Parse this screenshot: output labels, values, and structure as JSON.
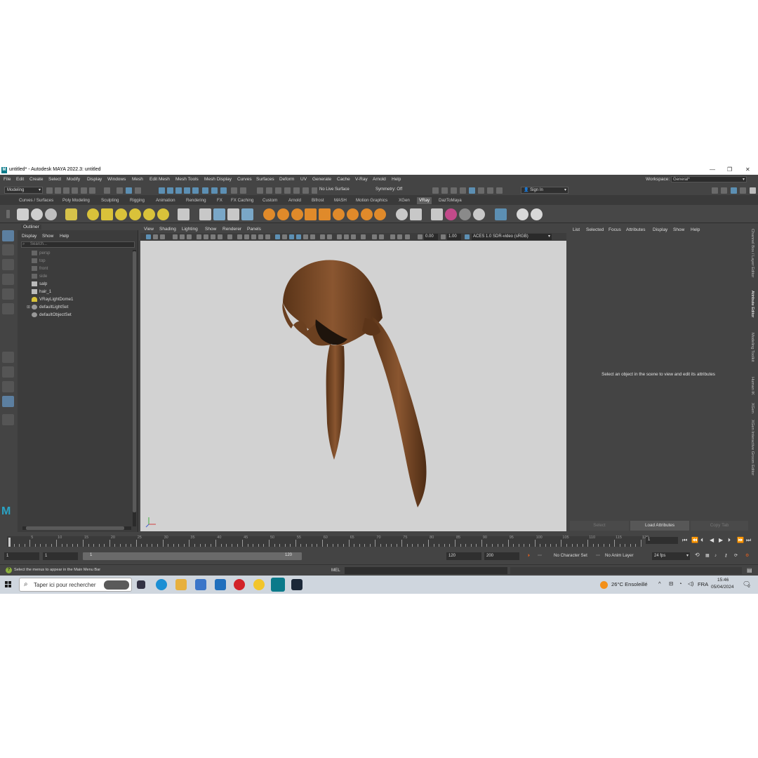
{
  "window": {
    "title": "untitled* - Autodesk MAYA 2022.3: untitled",
    "logo_letter": "M",
    "controls": [
      "—",
      "❐",
      "✕"
    ]
  },
  "menubar": {
    "items": [
      "File",
      "Edit",
      "Create",
      "Select",
      "Modify",
      "Display",
      "Windows",
      "Mesh",
      "Edit Mesh",
      "Mesh Tools",
      "Mesh Display",
      "Curves",
      "Surfaces",
      "Deform",
      "UV",
      "Generate",
      "Cache",
      "V-Ray",
      "Arnold",
      "Help"
    ],
    "workspace_label": "Workspace:",
    "workspace_value": "General*"
  },
  "statusline": {
    "menuset": "Modeling",
    "live_surface": "No Live Surface",
    "symmetry": "Symmetry: Off",
    "sign_in": "Sign In"
  },
  "shelf_tabs": [
    "Curves / Surfaces",
    "Poly Modeling",
    "Sculpting",
    "Rigging",
    "Animation",
    "Rendering",
    "FX",
    "FX Caching",
    "Custom",
    "Arnold",
    "Bifrost",
    "MASH",
    "Motion Graphics",
    "XGen",
    "VRay",
    "DazToMaya"
  ],
  "shelf_active": "VRay",
  "outliner": {
    "title": "Outliner",
    "menu": [
      "Display",
      "Show",
      "Help"
    ],
    "search_placeholder": "Search...",
    "items": [
      {
        "label": "persp",
        "icon": "camera-icon",
        "dim": true
      },
      {
        "label": "top",
        "icon": "camera-icon",
        "dim": true
      },
      {
        "label": "front",
        "icon": "camera-icon",
        "dim": true
      },
      {
        "label": "side",
        "icon": "camera-icon",
        "dim": true
      },
      {
        "label": "salp",
        "icon": "transform-icon",
        "dim": false
      },
      {
        "label": "hair_1",
        "icon": "transform-icon",
        "dim": false
      },
      {
        "label": "VRayLightDome1",
        "icon": "light-dome-icon",
        "dim": false
      },
      {
        "label": "defaultLightSet",
        "icon": "set-icon",
        "dim": false
      },
      {
        "label": "defaultObjectSet",
        "icon": "set-icon",
        "dim": false
      }
    ]
  },
  "viewport": {
    "menu": [
      "View",
      "Shading",
      "Lighting",
      "Show",
      "Renderer",
      "Panels"
    ],
    "near_value": "0.00",
    "gamma_value": "1.00",
    "color_space": "ACES 1.0 SDR-video (sRGB)",
    "background_color": "#d2d2d2",
    "hair_color": "#7a4a24"
  },
  "attribute_editor": {
    "menu": [
      "List",
      "Selected",
      "Focus",
      "Attributes",
      "Display",
      "Show",
      "Help"
    ],
    "message": "Select an object in the scene to view and edit its attributes",
    "buttons": [
      "Select",
      "Load Attributes",
      "Copy Tab"
    ]
  },
  "side_tabs": [
    "Channel Box / Layer Editor",
    "Attribute Editor",
    "Modeling Toolkit",
    "Human IK",
    "XGen",
    "XGen Interactive Groom Editor"
  ],
  "time_slider": {
    "labels": [
      "5",
      "10",
      "15",
      "20",
      "25",
      "30",
      "35",
      "40",
      "45",
      "50",
      "55",
      "60",
      "65",
      "70",
      "75",
      "80",
      "85",
      "90",
      "95",
      "100",
      "105",
      "110",
      "115",
      "120"
    ],
    "current_frame": "1",
    "playback_icons": [
      "⏮",
      "⏴⏴",
      "⏮",
      "◀",
      "▶",
      "⏭",
      "⏵⏵",
      "⏭"
    ]
  },
  "range_slider": {
    "start": "1",
    "playback_start": "1",
    "bar_start": "1",
    "bar_end": "120",
    "playback_end": "120",
    "end": "200",
    "character_set": "No Character Set",
    "anim_layer": "No Anim Layer",
    "fps": "24 fps"
  },
  "command_line": {
    "help_text": "Select the menus to appear in the Main Menu Bar",
    "language": "MEL"
  },
  "taskbar": {
    "search_placeholder": "Taper ici pour rechercher",
    "weather": "26°C  Ensoleillé",
    "language": "FRA",
    "time": "15:46",
    "date": "05/04/2024",
    "notification_count": "2"
  }
}
